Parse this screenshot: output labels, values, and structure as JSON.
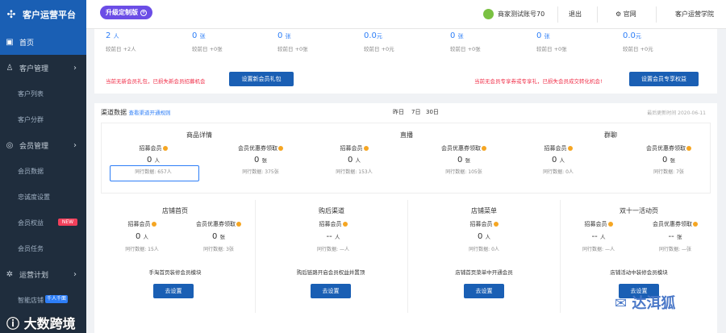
{
  "app": {
    "title": "客户运营平台",
    "upgrade": "升级定制版"
  },
  "topbar": {
    "account": "商家测试账号70",
    "logout": "退出",
    "site": "官网",
    "academy": "客户运营学院"
  },
  "nav": {
    "home": "首页",
    "customer": "客户管理",
    "customer_list": "客户列表",
    "customer_segment": "客户分群",
    "member": "会员管理",
    "member_data": "会员数据",
    "loyalty": "忠诚度设置",
    "member_rights": "会员权益",
    "member_rights_badge": "NEW",
    "member_task": "会员任务",
    "ops": "运营计划",
    "smart_store": "智能店铺",
    "smart_store_badge": "千人千面"
  },
  "stats": [
    {
      "value": "2",
      "unit": "人",
      "compare": "较前日 +2人"
    },
    {
      "value": "0",
      "unit": "张",
      "compare": "较前日 +0张"
    },
    {
      "value": "0",
      "unit": "张",
      "compare": "较前日 +0张"
    },
    {
      "value": "0.0",
      "unit": "元",
      "compare": "较前日 +0元"
    },
    {
      "value": "0",
      "unit": "张",
      "compare": "较前日 +0张"
    },
    {
      "value": "0",
      "unit": "张",
      "compare": "较前日 +0张"
    },
    {
      "value": "0.0",
      "unit": "元",
      "compare": "较前日 +0元"
    }
  ],
  "alerts": {
    "left_text": "当前无新会员礼包，已损失新会员招募机会",
    "left_btn": "设置新会员礼包",
    "right_text": "当前无会员专享券或专享礼，已损失会员成交转化机会!",
    "right_btn": "设置会员专享权益"
  },
  "channel": {
    "title": "渠道数据",
    "rules_link": "查看渠道开通规则",
    "ranges": [
      "昨日",
      "7日",
      "30日"
    ],
    "updated": "最后更新时间 2020-06-11"
  },
  "labels": {
    "recruit": "招募会员",
    "coupon": "会员优惠券领取",
    "peer": "同行数据:",
    "setup": "去设置"
  },
  "row1": [
    {
      "title": "商品详情",
      "recruit": "0",
      "recruit_unit": "人",
      "recruit_peer": "657人",
      "coupon": "0",
      "coupon_unit": "张",
      "coupon_peer": "375张"
    },
    {
      "title": "直播",
      "recruit": "0",
      "recruit_unit": "人",
      "recruit_peer": "153人",
      "coupon": "0",
      "coupon_unit": "张",
      "coupon_peer": "105张"
    },
    {
      "title": "群聊",
      "recruit": "0",
      "recruit_unit": "人",
      "recruit_peer": "0人",
      "coupon": "0",
      "coupon_unit": "张",
      "coupon_peer": "7张"
    }
  ],
  "row2": [
    {
      "title": "店铺首页",
      "recruit": "0",
      "recruit_unit": "人",
      "recruit_peer": "15人",
      "coupon": "0",
      "coupon_unit": "张",
      "coupon_peer": "3张",
      "desc": "手淘首页装修会员模块"
    },
    {
      "title": "购后渠道",
      "recruit": "--",
      "recruit_unit": "人",
      "recruit_peer": "—人",
      "coupon": "",
      "coupon_unit": "",
      "coupon_peer": "",
      "desc": "购后链路开启会员权益并置顶"
    },
    {
      "title": "店铺菜单",
      "recruit": "0",
      "recruit_unit": "人",
      "recruit_peer": "0人",
      "coupon": "",
      "coupon_unit": "",
      "coupon_peer": "",
      "desc": "店铺首页菜单中开通会员"
    },
    {
      "title": "双十一活动页",
      "recruit": "--",
      "recruit_unit": "人",
      "recruit_peer": "—人",
      "coupon": "--",
      "coupon_unit": "张",
      "coupon_peer": "—张",
      "desc": "店铺活动中装修会员模块"
    }
  ],
  "watermarks": {
    "left": "大数跨境",
    "right": "达洱狐"
  }
}
